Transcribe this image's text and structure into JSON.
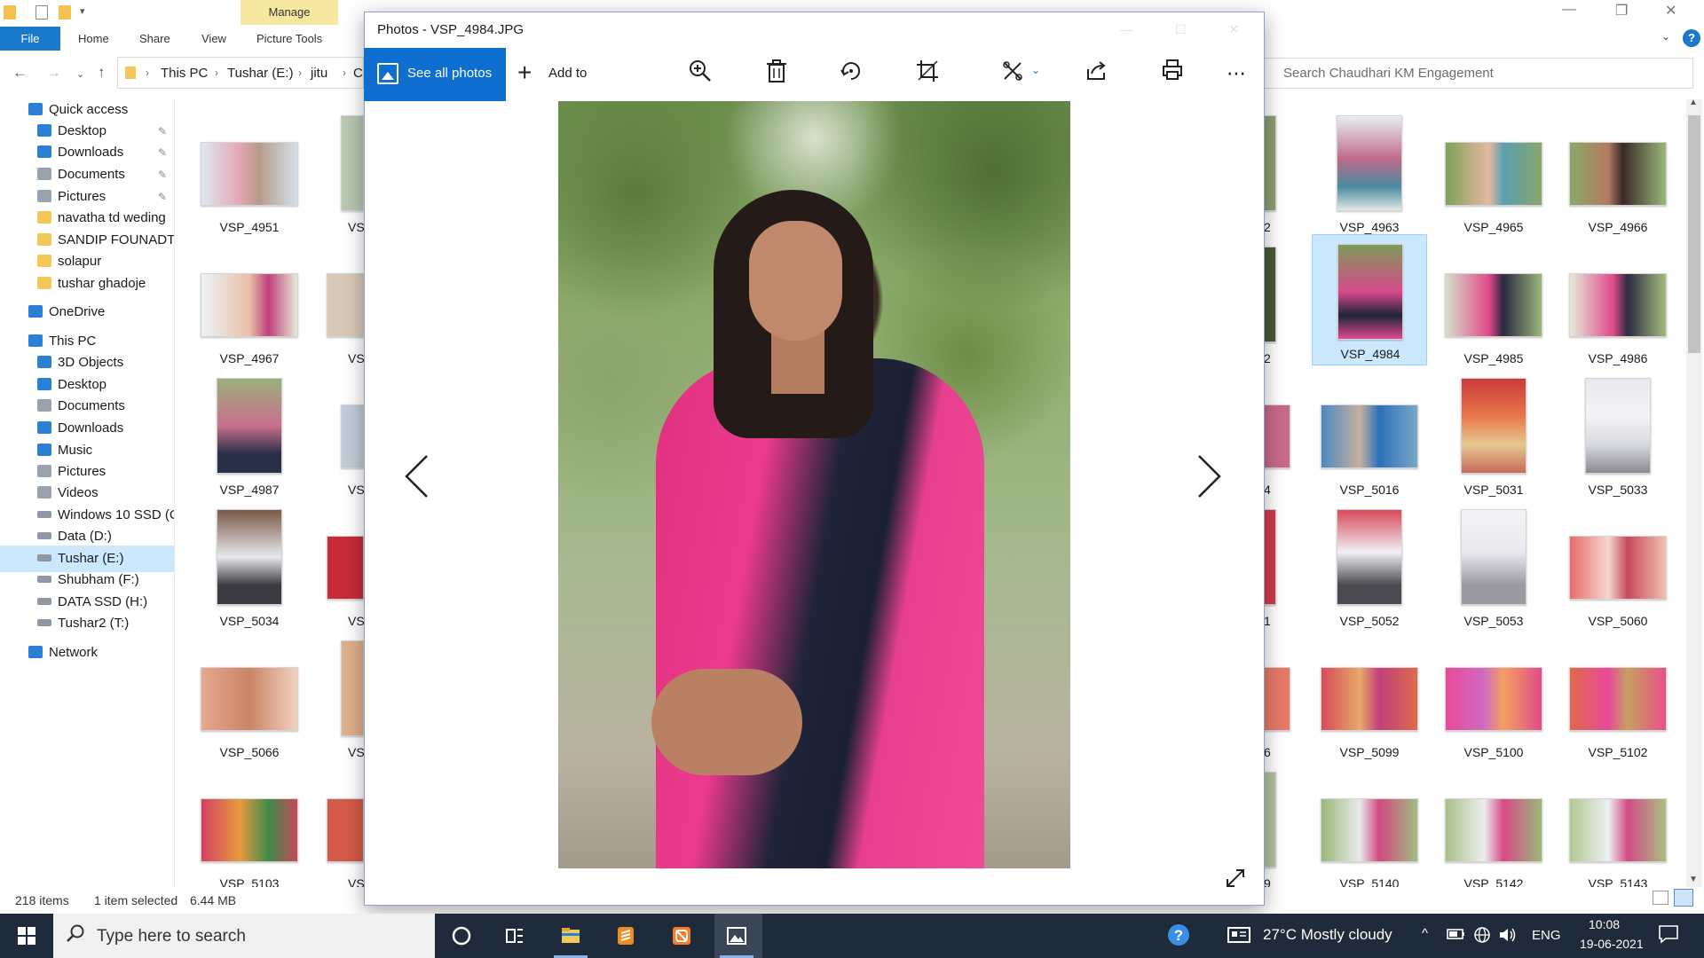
{
  "explorer": {
    "ribbon": {
      "manage_tab": "Manage",
      "file_tab": "File",
      "home_tab": "Home",
      "share_tab": "Share",
      "view_tab": "View",
      "picture_tools_tab": "Picture Tools"
    },
    "breadcrumb": [
      "This PC",
      "Tushar (E:)",
      "jitu",
      "C"
    ],
    "search_placeholder": "Search Chaudhari KM Engagement",
    "nav": [
      {
        "label": "Quick access",
        "icon": "star-icon",
        "pinned": false
      },
      {
        "label": "Desktop",
        "icon": "desktop-icon",
        "pinned": true
      },
      {
        "label": "Downloads",
        "icon": "download-icon",
        "pinned": true
      },
      {
        "label": "Documents",
        "icon": "documents-icon",
        "pinned": true
      },
      {
        "label": "Pictures",
        "icon": "pictures-icon",
        "pinned": true
      },
      {
        "label": "navatha td weding",
        "icon": "folder-icon",
        "pinned": false
      },
      {
        "label": "SANDIP FOUNADTI(",
        "icon": "folder-icon",
        "pinned": false
      },
      {
        "label": "solapur",
        "icon": "folder-icon",
        "pinned": false
      },
      {
        "label": "tushar ghadoje",
        "icon": "folder-icon",
        "pinned": false
      },
      {
        "label": "OneDrive",
        "icon": "cloud-icon",
        "pinned": false
      },
      {
        "label": "This PC",
        "icon": "computer-icon",
        "pinned": false
      },
      {
        "label": "3D Objects",
        "icon": "cube-icon",
        "pinned": false
      },
      {
        "label": "Desktop",
        "icon": "desktop-icon",
        "pinned": false
      },
      {
        "label": "Documents",
        "icon": "documents-icon",
        "pinned": false
      },
      {
        "label": "Downloads",
        "icon": "download-icon",
        "pinned": false
      },
      {
        "label": "Music",
        "icon": "music-icon",
        "pinned": false
      },
      {
        "label": "Pictures",
        "icon": "pictures-icon",
        "pinned": false
      },
      {
        "label": "Videos",
        "icon": "videos-icon",
        "pinned": false
      },
      {
        "label": "Windows 10 SSD (C",
        "icon": "drive-icon",
        "pinned": false
      },
      {
        "label": "Data (D:)",
        "icon": "drive-icon",
        "pinned": false
      },
      {
        "label": "Tushar (E:)",
        "icon": "drive-icon",
        "pinned": false,
        "selected": true
      },
      {
        "label": "Shubham (F:)",
        "icon": "drive-icon",
        "pinned": false
      },
      {
        "label": "DATA SSD (H:)",
        "icon": "drive-icon",
        "pinned": false
      },
      {
        "label": "Tushar2 (T:)",
        "icon": "drive-icon",
        "pinned": false
      },
      {
        "label": "Network",
        "icon": "network-icon",
        "pinned": false
      }
    ],
    "thumbs_left": [
      "VSP_4951",
      "VSP_4967",
      "VSP_4987",
      "VSP_5034",
      "VSP_5066",
      "VSP_5103"
    ],
    "thumbs_partial_left": [
      "VS",
      "VS",
      "VS",
      "VS",
      "VS",
      "VS"
    ],
    "thumbs_partial_right": [
      "2",
      "2",
      "4",
      "1",
      "6",
      "9"
    ],
    "thumbs_right": [
      [
        "VSP_4963",
        "VSP_4965",
        "VSP_4966"
      ],
      [
        "VSP_4984",
        "VSP_4985",
        "VSP_4986"
      ],
      [
        "VSP_5016",
        "VSP_5031",
        "VSP_5033"
      ],
      [
        "VSP_5052",
        "VSP_5053",
        "VSP_5060"
      ],
      [
        "VSP_5099",
        "VSP_5100",
        "VSP_5102"
      ],
      [
        "VSP_5140",
        "VSP_5142",
        "VSP_5143"
      ]
    ],
    "selected_thumb": "VSP_4984",
    "status": {
      "items": "218 items",
      "selected": "1 item selected",
      "size": "6.44 MB"
    }
  },
  "photos": {
    "title": "Photos - VSP_4984.JPG",
    "see_all_label": "See all photos",
    "add_to_label": "Add to",
    "tools": [
      "zoom-icon",
      "delete-icon",
      "rotate-icon",
      "crop-icon",
      "edit-icon",
      "share-icon",
      "print-icon",
      "more-icon"
    ],
    "accent": "#0f6fd1"
  },
  "taskbar": {
    "search_placeholder": "Type here to search",
    "weather": "27°C  Mostly cloudy",
    "language": "ENG",
    "time": "10:08",
    "date": "19-06-2021"
  }
}
